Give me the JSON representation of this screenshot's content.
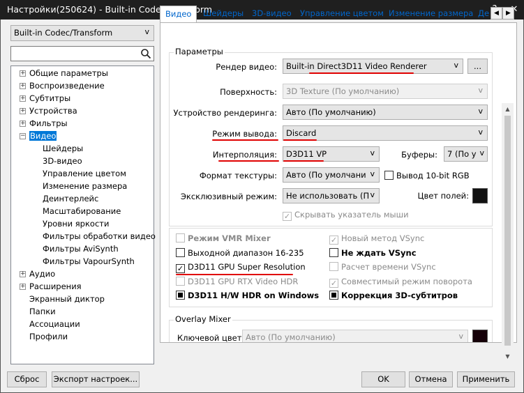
{
  "window": {
    "title": "Настройки(250624) - Built-in Codec/Transform",
    "help_label": "?",
    "close_label": "✕"
  },
  "left": {
    "category_combo": "Built-in Codec/Transform",
    "search_placeholder": "",
    "tree": [
      {
        "label": "Общие параметры",
        "expander": "+"
      },
      {
        "label": "Воспроизведение",
        "expander": "+"
      },
      {
        "label": "Субтитры",
        "expander": "+"
      },
      {
        "label": "Устройства",
        "expander": "+"
      },
      {
        "label": "Фильтры",
        "expander": "+"
      },
      {
        "label": "Видео",
        "expander": "−"
      },
      {
        "label": "Шейдеры"
      },
      {
        "label": "3D-видео"
      },
      {
        "label": "Управление цветом"
      },
      {
        "label": "Изменение размера"
      },
      {
        "label": "Деинтерлейс"
      },
      {
        "label": "Масштабирование"
      },
      {
        "label": "Уровни яркости"
      },
      {
        "label": "Фильтры обработки видео"
      },
      {
        "label": "Фильтры AviSynth"
      },
      {
        "label": "Фильтры VapourSynth"
      },
      {
        "label": "Аудио",
        "expander": "+"
      },
      {
        "label": "Расширения",
        "expander": "+"
      },
      {
        "label": "Экранный диктор"
      },
      {
        "label": "Папки"
      },
      {
        "label": "Ассоциации"
      },
      {
        "label": "Профили"
      }
    ]
  },
  "tabs": [
    "Видео",
    "Шейдеры",
    "3D-видео",
    "Управление цветом",
    "Изменение размера",
    "Де"
  ],
  "params": {
    "group_title": "Параметры",
    "renderer_label": "Рендер видео:",
    "renderer_value": "Built-in Direct3D11 Video Renderer",
    "renderer_more": "...",
    "surface_label": "Поверхность:",
    "surface_value": "3D Texture (По умолчанию)",
    "device_label": "Устройство рендеринга:",
    "device_value": "Авто (По умолчанию)",
    "output_label": "Режим вывода:",
    "output_value": "Discard",
    "interp_label": "Интерполяция:",
    "interp_value": "D3D11 VP",
    "buffers_label": "Буферы:",
    "buffers_value": "7 (По у",
    "texture_label": "Формат текстуры:",
    "texture_value": "Авто (По умолчани",
    "out10_label": "Вывод 10-bit RGB",
    "exclusive_label": "Эксклюзивный режим:",
    "exclusive_value": "Не использовать (П",
    "border_color_label": "Цвет полей:",
    "hide_cursor_label": "Скрывать указатель мыши"
  },
  "options": [
    {
      "label": "Режим VMR Mixer",
      "checked": false,
      "disabled": true,
      "bold": true
    },
    {
      "label": "Новый метод VSync",
      "checked": true,
      "disabled": true,
      "bold": false
    },
    {
      "label": "Выходной диапазон 16-235",
      "checked": false,
      "disabled": false,
      "bold": false
    },
    {
      "label": "Не ждать VSync",
      "checked": false,
      "disabled": false,
      "bold": true
    },
    {
      "label": "D3D11 GPU Super Resolution",
      "checked": true,
      "disabled": false,
      "bold": false
    },
    {
      "label": "Расчет времени VSync",
      "checked": false,
      "disabled": true,
      "bold": false
    },
    {
      "label": "D3D11 GPU RTX Video HDR",
      "checked": false,
      "disabled": true,
      "bold": false
    },
    {
      "label": "Совместимый режим поворота",
      "checked": true,
      "disabled": true,
      "bold": false
    },
    {
      "label": "D3D11 H/W HDR on Windows",
      "checked": "indeterminate",
      "disabled": false,
      "bold": true
    },
    {
      "label": "Коррекция 3D-субтитров",
      "checked": "indeterminate",
      "disabled": false,
      "bold": true
    }
  ],
  "overlay": {
    "group_title": "Overlay Mixer",
    "key_color_label": "Ключевой цвет:",
    "key_color_value": "Авто (По умолчанию)"
  },
  "footer": {
    "reset": "Сброс",
    "export": "Экспорт настроек...",
    "ok": "OK",
    "cancel": "Отмена",
    "apply": "Применить"
  },
  "colors": {
    "accent": "#0078d7",
    "tab_text": "#0066cc",
    "underline": "#e00000"
  }
}
